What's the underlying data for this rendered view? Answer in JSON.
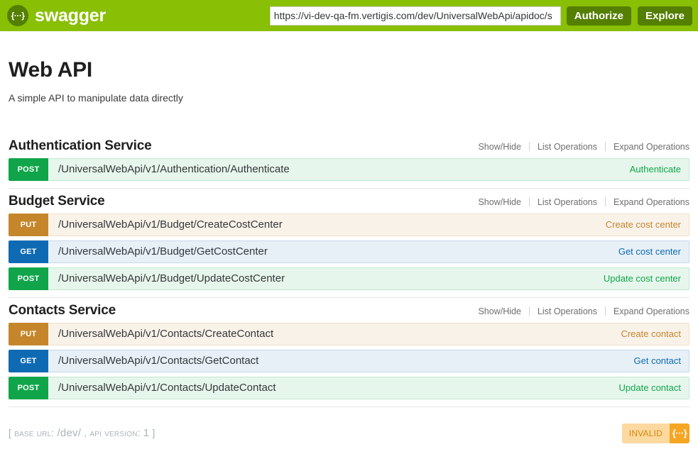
{
  "topbar": {
    "logo_glyph": "{···}",
    "brand": "swagger",
    "url_value": "https://vi-dev-qa-fm.vertigis.com/dev/UniversalWebApi/apidoc/s",
    "url_placeholder": "http://example.com/api",
    "authorize_label": "Authorize",
    "explore_label": "Explore"
  },
  "info": {
    "title": "Web API",
    "description": "A simple API to manipulate data directly"
  },
  "links": {
    "show_hide": "Show/Hide",
    "list_operations": "List Operations",
    "expand_operations": "Expand Operations"
  },
  "resources": [
    {
      "name": "Authentication Service",
      "operations": [
        {
          "method": "POST",
          "method_class": "m-post",
          "path": "/UniversalWebApi/v1/Authentication/Authenticate",
          "summary": "Authenticate"
        }
      ]
    },
    {
      "name": "Budget Service",
      "operations": [
        {
          "method": "PUT",
          "method_class": "m-put",
          "path": "/UniversalWebApi/v1/Budget/CreateCostCenter",
          "summary": "Create cost center"
        },
        {
          "method": "GET",
          "method_class": "m-get",
          "path": "/UniversalWebApi/v1/Budget/GetCostCenter",
          "summary": "Get cost center"
        },
        {
          "method": "POST",
          "method_class": "m-post",
          "path": "/UniversalWebApi/v1/Budget/UpdateCostCenter",
          "summary": "Update cost center"
        }
      ]
    },
    {
      "name": "Contacts Service",
      "operations": [
        {
          "method": "PUT",
          "method_class": "m-put",
          "path": "/UniversalWebApi/v1/Contacts/CreateContact",
          "summary": "Create contact"
        },
        {
          "method": "GET",
          "method_class": "m-get",
          "path": "/UniversalWebApi/v1/Contacts/GetContact",
          "summary": "Get contact"
        },
        {
          "method": "POST",
          "method_class": "m-post",
          "path": "/UniversalWebApi/v1/Contacts/UpdateContact",
          "summary": "Update contact"
        }
      ]
    }
  ],
  "footer": {
    "bracket_open": "[",
    "base_url_label": "BASE URL:",
    "base_url_value": "/dev/",
    "comma": ",",
    "api_version_label": "API VERSION:",
    "api_version_value": "1",
    "bracket_close": "]",
    "validator_status": "INVALID",
    "validator_glyph": "{···}"
  },
  "colors": {
    "header_green": "#89bf04",
    "button_green": "#547f00",
    "post_green": "#10a54a",
    "put_orange": "#c5862b",
    "get_blue": "#0f6ab4",
    "validator_orange": "#f5a623"
  }
}
